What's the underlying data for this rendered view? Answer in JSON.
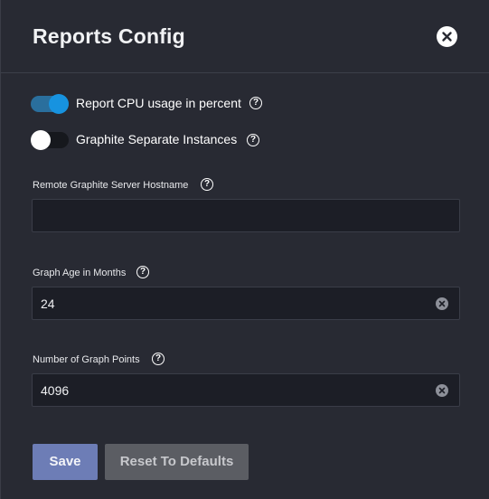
{
  "dialog": {
    "title": "Reports Config",
    "close_label": "close"
  },
  "toggles": [
    {
      "label": "Report CPU usage in percent",
      "checked": true
    },
    {
      "label": "Graphite Separate Instances",
      "checked": false
    }
  ],
  "fields": {
    "graphite_host": {
      "label": "Remote Graphite Server Hostname",
      "value": ""
    },
    "graph_age": {
      "label": "Graph Age in Months",
      "value": "24"
    },
    "graph_points": {
      "label": "Number of Graph Points",
      "value": "4096"
    }
  },
  "actions": {
    "save_label": "Save",
    "reset_label": "Reset To Defaults"
  },
  "help_glyph": "?",
  "colors": {
    "background": "#282a33",
    "toggle_on": "#1793e0",
    "save_button": "#6d7db6",
    "reset_button": "#5b5d63"
  }
}
